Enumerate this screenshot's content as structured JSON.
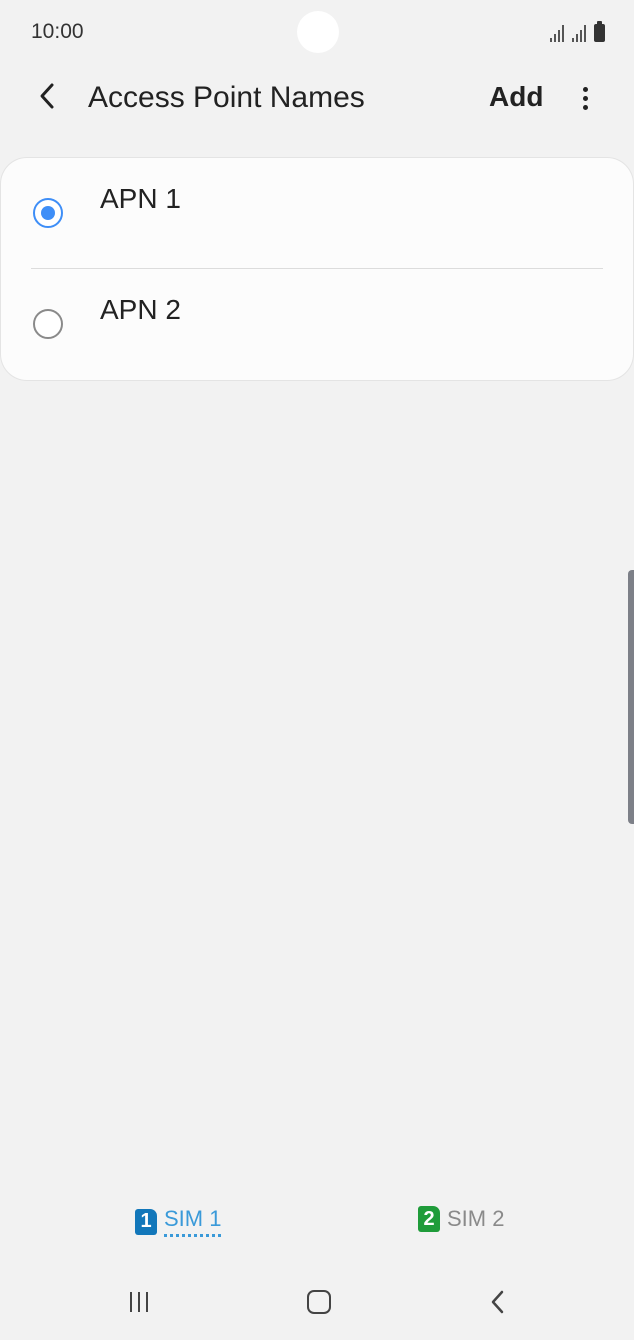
{
  "status_bar": {
    "time": "10:00",
    "icons": [
      "signal-sim1-icon",
      "signal-sim2-icon",
      "battery-icon"
    ]
  },
  "app_bar": {
    "title": "Access Point Names",
    "add_label": "Add",
    "back_icon": "chevron-left-icon",
    "more_icon": "more-vertical-icon"
  },
  "apn_list": {
    "items": [
      {
        "label": "APN 1",
        "selected": true
      },
      {
        "label": "APN 2",
        "selected": false
      }
    ]
  },
  "sim_tabs": {
    "items": [
      {
        "badge": "1",
        "label": "SIM 1",
        "active": true
      },
      {
        "badge": "2",
        "label": "SIM 2",
        "active": false
      }
    ]
  },
  "nav_bar": {
    "icons": [
      "recents-icon",
      "home-icon",
      "back-icon"
    ]
  },
  "colors": {
    "background": "#f2f2f2",
    "accent": "#3e8ef7",
    "sim1": "#1277ba",
    "sim2": "#1f9c3a"
  }
}
